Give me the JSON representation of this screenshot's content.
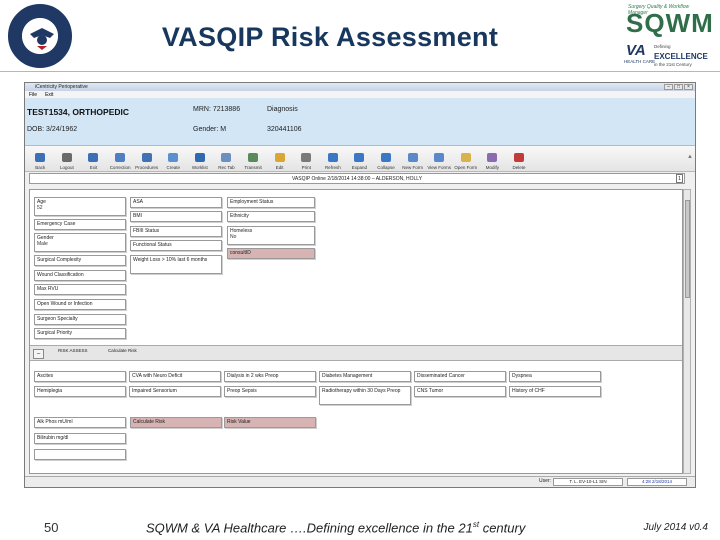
{
  "slide": {
    "title": "VASQIP Risk Assessment",
    "page_number": "50",
    "footer_text_pre": "SQWM & VA Healthcare ….Defining excellence in the 21",
    "footer_text_sup": "st",
    "footer_text_post": " century",
    "footer_date": "July 2014 v0.4"
  },
  "logo": {
    "small_text": "Surgery Quality & Workflow Manager",
    "main_text": "SQWM",
    "va_text": "VA",
    "va_sub": "HEALTH CARE",
    "excel_line1": "Defining",
    "excel_line2": "EXCELLENCE",
    "excel_line3": "in the 21st Century",
    "brand_color": "#2f6e49"
  },
  "window": {
    "title": "iCentricity Perioperative",
    "menu": [
      "File",
      "Exit"
    ],
    "controls": [
      "–",
      "□",
      "×"
    ]
  },
  "patient": {
    "name": "TEST1534, ORTHOPEDIC",
    "dob": "DOB: 3/24/1962",
    "mrn": "MRN: 7213886",
    "gender": "Gender: M",
    "diagnosis_label": "Diagnosis",
    "diagnosis_value": "320441106"
  },
  "toolbar": [
    {
      "label": "Back",
      "icon": "back-arrow-icon",
      "color": "#3b6fb6"
    },
    {
      "label": "Logout",
      "icon": "logout-icon",
      "color": "#6a6a6a"
    },
    {
      "label": "Exit",
      "icon": "exit-icon",
      "color": "#3b6fb6"
    },
    {
      "label": "Correction",
      "icon": "correction-icon",
      "color": "#4e7fc2"
    },
    {
      "label": "Procedures",
      "icon": "procedures-icon",
      "color": "#3f72b5"
    },
    {
      "label": "Create",
      "icon": "create-icon",
      "color": "#5a8fd0"
    },
    {
      "label": "Worklist",
      "icon": "worklist-icon",
      "color": "#2f6ab0"
    },
    {
      "label": "Rec Tab",
      "icon": "rec-tab-icon",
      "color": "#6a8fc0"
    },
    {
      "label": "Transmit",
      "icon": "transmit-icon",
      "color": "#5a8a5a"
    },
    {
      "label": "Edit",
      "icon": "edit-icon",
      "color": "#d9a634"
    },
    {
      "label": "Print",
      "icon": "print-icon",
      "color": "#7a7a7a"
    },
    {
      "label": "Refresh",
      "icon": "refresh-icon",
      "color": "#3a78c6"
    },
    {
      "label": "Expand",
      "icon": "expand-icon",
      "color": "#3a78c6"
    },
    {
      "label": "Collapse",
      "icon": "collapse-icon",
      "color": "#3a78c6"
    },
    {
      "label": "New Form",
      "icon": "new-form-icon",
      "color": "#5a88c8"
    },
    {
      "label": "View Forms",
      "icon": "view-forms-icon",
      "color": "#5a88c8"
    },
    {
      "label": "Open Form",
      "icon": "open-form-icon",
      "color": "#d8b24a"
    },
    {
      "label": "Modify",
      "icon": "modify-icon",
      "color": "#8a6bb0"
    },
    {
      "label": "Delete",
      "icon": "delete-icon",
      "color": "#c23a3a"
    }
  ],
  "form": {
    "title": "VASQIP Online 2/18/2014 14:38:00 – ALDERSON, HOLLY",
    "page_num": "1",
    "fields": {
      "age": {
        "label": "Age",
        "value": "52"
      },
      "emergency": {
        "label": "Emergency Case"
      },
      "gender": {
        "label": "Gender",
        "value": "Male"
      },
      "surgical_complexity": {
        "label": "Surgical Complexity"
      },
      "wound_class": {
        "label": "Wound Classification"
      },
      "max_rvu": {
        "label": "Max RVU"
      },
      "open_wound": {
        "label": "Open Wound or Infection"
      },
      "surgeon_specialty": {
        "label": "Surgeon Specialty"
      },
      "surgical_priority": {
        "label": "Surgical Priority"
      },
      "asa": {
        "label": "ASA"
      },
      "bmi": {
        "label": "BMI"
      },
      "fbi_status": {
        "label": "FBIII Status"
      },
      "functional_status": {
        "label": "Functional Status"
      },
      "weight_loss": {
        "label": "Weight Loss > 10% last 6 months"
      },
      "employment": {
        "label": "Employment Status"
      },
      "ethnicity": {
        "label": "Ethnicity"
      },
      "homeless": {
        "label": "Homeless",
        "value": "No"
      },
      "consult": {
        "label": "consultID"
      }
    },
    "risk_section": {
      "toggle": "–",
      "label": "RISK ASSESS",
      "calc_label": "Calculate Risk"
    },
    "risk_row1": [
      "Ascites",
      "CVA with Neuro Deficit",
      "Dialysis in 2 wks Preop",
      "Diabetes Management",
      "Disseminated Cancer",
      "Dyspnea"
    ],
    "risk_row2": [
      "Hemiplegia",
      "Impaired Sensorium",
      "Preop Sepsis",
      "Radiotherapy within 30 Days Preop",
      "CNS Tumor",
      "History of CHF"
    ],
    "labs": [
      "Alk Phos  mU/ml",
      "Bilirubin  mg/dl"
    ],
    "calc_buttons": [
      "Calculate Risk",
      "Risk Value"
    ]
  },
  "statusbar": {
    "user_label": "User:",
    "user_value": "T. L. EV-10-L1 SIN",
    "date": "4:28 2/18/2014"
  }
}
